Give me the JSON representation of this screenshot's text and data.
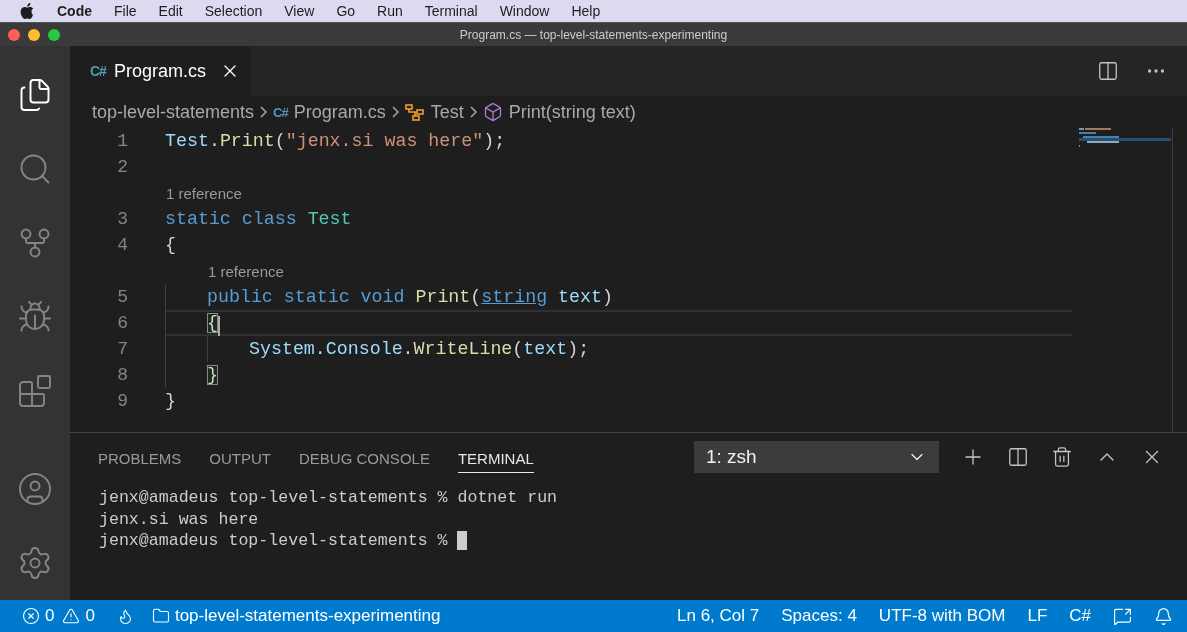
{
  "menu_bar": {
    "app": "Code",
    "items": [
      "File",
      "Edit",
      "Selection",
      "View",
      "Go",
      "Run",
      "Terminal",
      "Window",
      "Help"
    ]
  },
  "window": {
    "title": "Program.cs — top-level-statements-experimenting"
  },
  "activity_bar": [
    {
      "kind": "files",
      "selected": true
    },
    {
      "kind": "search",
      "selected": false
    },
    {
      "kind": "source-control",
      "selected": false
    },
    {
      "kind": "run",
      "selected": false
    },
    {
      "kind": "extensions",
      "selected": false
    },
    {
      "kind": "account",
      "selected": false
    },
    {
      "kind": "settings",
      "selected": false
    }
  ],
  "tabs": [
    {
      "icon": "C#",
      "label": "Program.cs",
      "selected": true
    }
  ],
  "breadcrumbs": [
    {
      "kind": "folder",
      "label": "top-level-statements"
    },
    {
      "kind": "file",
      "icon": "C#",
      "label": "Program.cs"
    },
    {
      "kind": "class",
      "label": "Test"
    },
    {
      "kind": "method",
      "label": "Print(string text)"
    }
  ],
  "editor": {
    "lines": [
      {
        "kind": "code",
        "number": "1",
        "indented": false,
        "deeply_indented": false,
        "current": false,
        "tokens": [
          {
            "kind": "variable",
            "text": "Test"
          },
          {
            "kind": "plain",
            "text": "."
          },
          {
            "kind": "method",
            "text": "Print"
          },
          {
            "kind": "plain",
            "text": "("
          },
          {
            "kind": "string",
            "text": "\"jenx.si was here\""
          },
          {
            "kind": "plain",
            "text": ");"
          }
        ]
      },
      {
        "kind": "code",
        "number": "2",
        "indented": false,
        "deeply_indented": false,
        "current": false
      },
      {
        "kind": "codelens",
        "indented": false,
        "text": "1 reference"
      },
      {
        "kind": "code",
        "number": "3",
        "indented": false,
        "deeply_indented": false,
        "current": false,
        "tokens": [
          {
            "kind": "keyword",
            "text": "static"
          },
          {
            "kind": "keyword",
            "text": "class",
            "spaced": true
          },
          {
            "kind": "class",
            "text": "Test",
            "spaced": true
          }
        ]
      },
      {
        "kind": "code",
        "number": "4",
        "indented": false,
        "deeply_indented": false,
        "current": false,
        "tokens": [
          {
            "kind": "plain",
            "text": "{"
          }
        ]
      },
      {
        "kind": "codelens",
        "indented": true,
        "text": "1 reference"
      },
      {
        "kind": "code",
        "number": "5",
        "indented": true,
        "deeply_indented": false,
        "current": false,
        "tokens": [
          {
            "kind": "keyword",
            "text": "public"
          },
          {
            "kind": "keyword",
            "text": "static",
            "spaced": true
          },
          {
            "kind": "keyword",
            "text": "void",
            "spaced": true
          },
          {
            "kind": "method",
            "text": "Print",
            "spaced": true
          },
          {
            "kind": "plain",
            "text": "("
          },
          {
            "kind": "type-link",
            "text": "string"
          },
          {
            "kind": "variable",
            "text": "text",
            "spaced": true
          },
          {
            "kind": "plain",
            "text": ")"
          }
        ]
      },
      {
        "kind": "code",
        "number": "6",
        "indented": true,
        "deeply_indented": false,
        "current": true,
        "tokens": [
          {
            "kind": "bracket-match",
            "text": "{"
          }
        ]
      },
      {
        "kind": "code",
        "number": "7",
        "indented": true,
        "deeply_indented": true,
        "current": false,
        "tokens": [
          {
            "kind": "variable",
            "text": "System"
          },
          {
            "kind": "plain",
            "text": "."
          },
          {
            "kind": "variable",
            "text": "Console"
          },
          {
            "kind": "plain",
            "text": "."
          },
          {
            "kind": "method",
            "text": "WriteLine"
          },
          {
            "kind": "plain",
            "text": "("
          },
          {
            "kind": "variable",
            "text": "text"
          },
          {
            "kind": "plain",
            "text": ");"
          }
        ]
      },
      {
        "kind": "code",
        "number": "8",
        "indented": true,
        "deeply_indented": false,
        "current": false,
        "tokens": [
          {
            "kind": "bracket-match",
            "text": "}"
          }
        ]
      },
      {
        "kind": "code",
        "number": "9",
        "indented": false,
        "deeply_indented": false,
        "current": false,
        "tokens": [
          {
            "kind": "plain",
            "text": "}"
          }
        ]
      }
    ]
  },
  "panel": {
    "tabs": [
      {
        "label": "PROBLEMS",
        "selected": false
      },
      {
        "label": "OUTPUT",
        "selected": false
      },
      {
        "label": "DEBUG CONSOLE",
        "selected": false
      },
      {
        "label": "TERMINAL",
        "selected": true
      }
    ],
    "terminal_select": {
      "value": "1: zsh"
    },
    "terminal_lines": [
      {
        "text": "jenx@amadeus top-level-statements % dotnet run",
        "cursor": false
      },
      {
        "text": "jenx.si was here",
        "cursor": false
      },
      {
        "text": "jenx@amadeus top-level-statements %",
        "cursor": true
      }
    ]
  },
  "status_bar": {
    "errors": "0",
    "warnings": "0",
    "folder": "top-level-statements-experimenting",
    "right": [
      "Ln 6, Col 7",
      "Spaces: 4",
      "UTF-8 with BOM",
      "LF",
      "C#"
    ]
  }
}
